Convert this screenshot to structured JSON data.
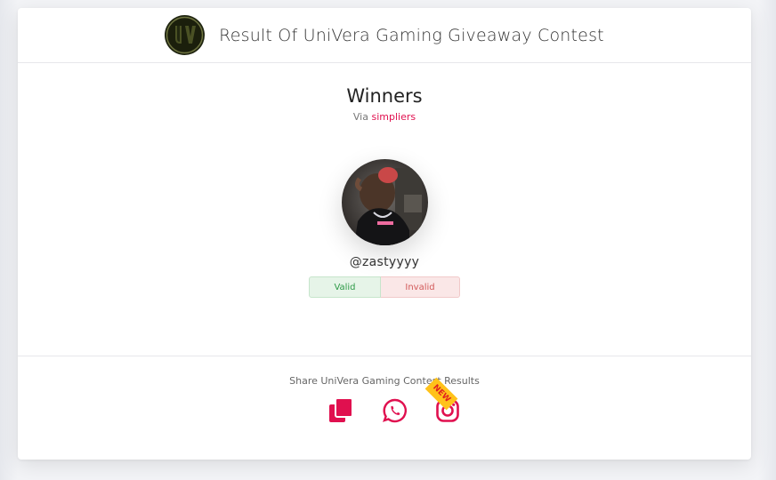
{
  "header": {
    "title": "Result Of UniVera Gaming Giveaway Contest",
    "logo_text": "UV"
  },
  "main": {
    "heading": "Winners",
    "via_prefix": "Via",
    "via_brand": "simpliers",
    "winner": {
      "username": "@zastyyyy"
    },
    "vote": {
      "valid_label": "Valid",
      "invalid_label": "Invalid"
    }
  },
  "footer": {
    "share_text": "Share UniVera Gaming Contest Results",
    "icons": [
      "copy-icon",
      "whatsapp-icon",
      "instagram-icon"
    ],
    "new_badge": "NEW"
  },
  "colors": {
    "accent": "#e0104f",
    "valid": "#2e9a48",
    "invalid": "#d25a5a",
    "badge": "#ffc21a"
  }
}
